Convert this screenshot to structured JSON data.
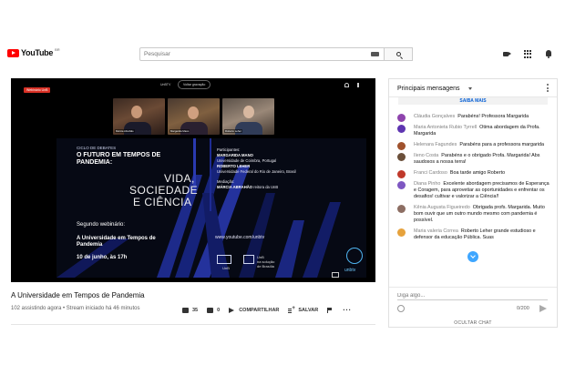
{
  "header": {
    "logo_text": "YouTube",
    "country": "BR",
    "search_placeholder": "Pesquisar"
  },
  "player": {
    "live_badge": "Webinário UnB",
    "top_label": "UnBTV",
    "back_button": "Voltar gravação",
    "participants": [
      {
        "name": "Márcia Abrahão"
      },
      {
        "name": "Margarida Mano"
      },
      {
        "name": "Roberto Leher"
      }
    ],
    "slide": {
      "ciclo": "CICLO DE DEBATES",
      "main_title": "O FUTURO EM TEMPOS DE PANDEMIA:",
      "vida_line1": "VIDA,",
      "vida_line2": "SOCIEDADE",
      "vida_line3": "E CIÊNCIA",
      "second": "Segundo webinário:",
      "webinar_name": "A Universidade em Tempos de Pandemia",
      "date": "10 de junho, às 17h",
      "participants_label": "Participantes:",
      "p1_name": "MARGARIDA MANO",
      "p1_inst": "Universidade de Coimbra, Portugal",
      "p2_name": "ROBERTO LEHER",
      "p2_inst": "Universidade Federal do Rio de Janeiro, Brasil",
      "mediation_label": "Mediação:",
      "mediator": "MÁRCIA ABRAHÃO",
      "mediator_role": " reitora da UnB",
      "url": "www.youtube.com/unbtv",
      "unb": "UnB",
      "unb2": "UnB\nna solução\nde Brasília",
      "unbtv": "unbtv"
    }
  },
  "video": {
    "title": "A Universidade em Tempos de Pandemia",
    "meta": "102 assistindo agora • Stream iniciado há 46 minutos",
    "likes": "35",
    "dislikes": "0",
    "share_label": "COMPARTILHAR",
    "save_label": "SALVAR"
  },
  "chat": {
    "title": "Principais mensagens",
    "saiba_mais": "SAIBA MAIS",
    "messages": [
      {
        "author": "Cláudia Gonçalves",
        "text": "Parabéns! Professora Margarida",
        "color": "#8e44ad"
      },
      {
        "author": "Maria Antonieta Rubio Tyrrell",
        "text": "Otima abordagem da Profa. Margarida",
        "color": "#5e35b1"
      },
      {
        "author": "Helenara Fagundes",
        "text": "Parabéns para a professora margarida",
        "color": "#a0522d"
      },
      {
        "author": "Ileno Costa",
        "text": "Parabéns e o obrigado Profa. Margarida! Abs saudosos a nossa terra!",
        "color": "#6b4f3a"
      },
      {
        "author": "Franci Cardoso",
        "text": "Boa tarde amigo Roberto",
        "color": "#c0392b"
      },
      {
        "author": "Diana Pinho",
        "text": "Excelente abordagem precisamos de Esperança e Coragem, para aprovetiar as oportunidades e enfrentar os desafios! cultivar e valorizar a Ciência!!",
        "color": "#7e57c2"
      },
      {
        "author": "Kênia Augusta Figueiredo",
        "text": "Obrigada profs. Margarida. Muito bom ouvir que um outro mundo mesmo com pandemia é possível.",
        "color": "#8d6e63"
      },
      {
        "author": "Maria valeria Correa",
        "text": "Roberto Leher grande estudioso e defensor da educação Pública. Suas",
        "color": "#e6a23c"
      }
    ],
    "input_placeholder": "Diga algo...",
    "counter": "0/200",
    "hide_label": "OCULTAR CHAT"
  }
}
